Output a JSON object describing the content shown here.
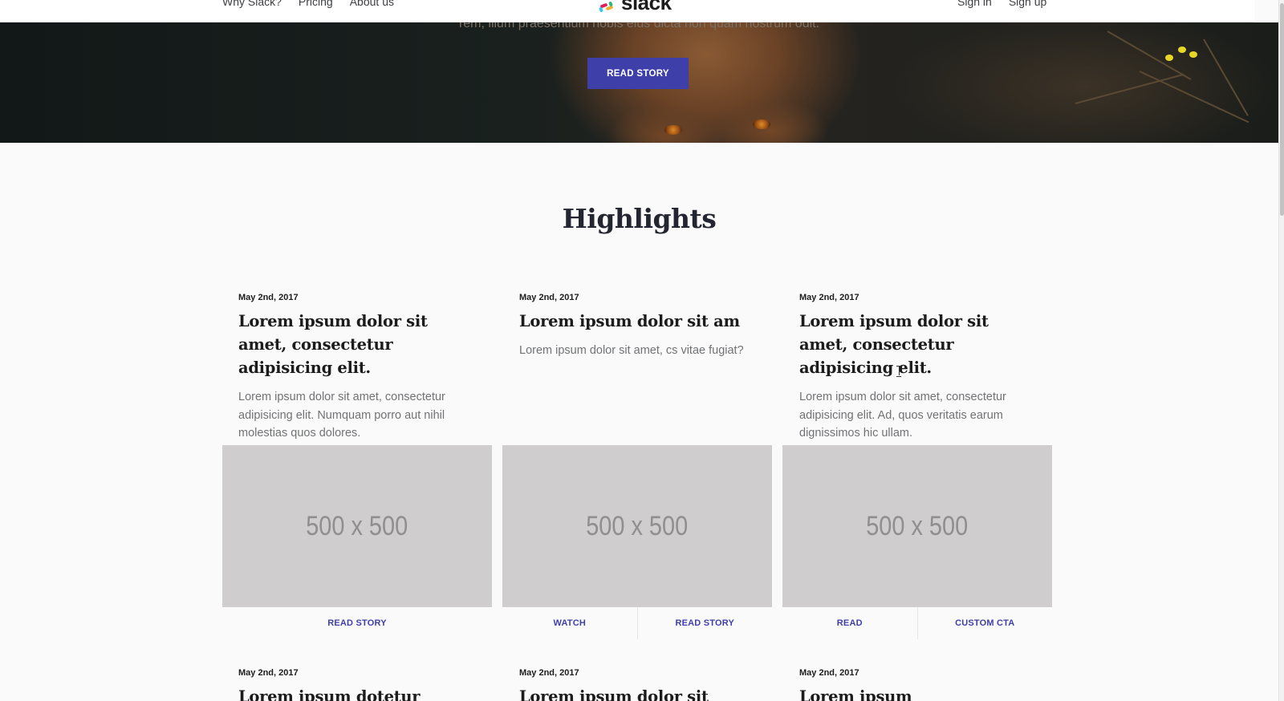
{
  "nav": {
    "left_links": [
      "Why Slack?",
      "Pricing",
      "About us"
    ],
    "logo_text": "slack",
    "right_links": [
      "Sign in",
      "Sign up"
    ]
  },
  "hero": {
    "text": "rem, illum praesentium nobis eius dicta non quam nostrum odit.",
    "button_label": "READ STORY",
    "button_color": "#3e3fa8"
  },
  "highlights": {
    "title": "Highlights",
    "cards": [
      {
        "date": "May 2nd, 2017",
        "title": "Lorem ipsum dolor sit amet, consectetur adipisicing elit.",
        "description": "Lorem ipsum dolor sit amet, consectetur adipisicing elit. Numquam porro aut nihil molestias quos dolores.",
        "image_label": "500 x 500",
        "ctas": [
          "READ STORY"
        ]
      },
      {
        "date": "May 2nd, 2017",
        "title": "Lorem ipsum dolor sit am",
        "description": "Lorem ipsum dolor sit amet, cs vitae fugiat?",
        "image_label": "500 x 500",
        "ctas": [
          "WATCH",
          "READ STORY"
        ]
      },
      {
        "date": "May 2nd, 2017",
        "title": "Lorem ipsum dolor sit amet, consectetur adipisicing elit.",
        "description": "Lorem ipsum dolor sit amet, consectetur adipisicing elit. Ad, quos veritatis earum dignissimos hic ullam.",
        "image_label": "500 x 500",
        "ctas": [
          "READ",
          "CUSTOM CTA"
        ]
      }
    ],
    "next_row": [
      {
        "date": "May 2nd, 2017",
        "title": "Lorem ipsum dotetur"
      },
      {
        "date": "May 2nd, 2017",
        "title": "Lorem ipsum dolor sit amet,"
      },
      {
        "date": "May 2nd, 2017",
        "title": "Lorem ipsum"
      }
    ]
  }
}
